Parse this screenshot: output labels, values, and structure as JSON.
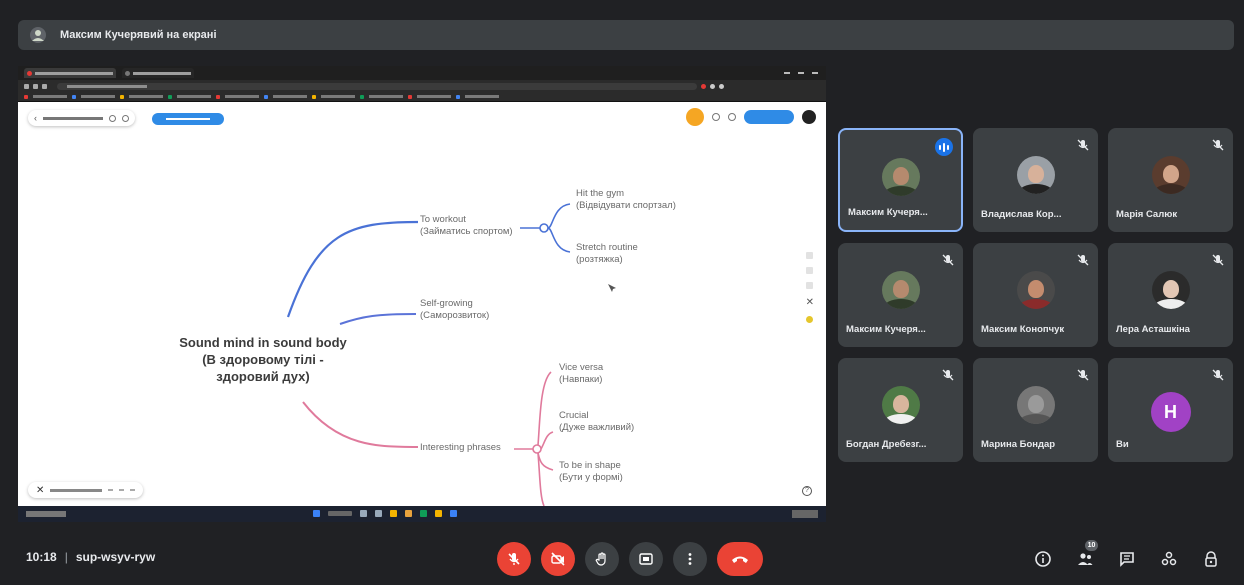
{
  "banner": {
    "text": "Максим Кучерявий на екрані"
  },
  "mindmap": {
    "root": [
      "Sound mind in sound body",
      "(В здоровому тілі -",
      "здоровий дух)"
    ],
    "branch_workout": [
      "To workout",
      "(Займатись спортом)"
    ],
    "leaf_gym": [
      "Hit the gym",
      "(Відвідувати спортзал)"
    ],
    "leaf_stretch": [
      "Stretch routine",
      "(розтяжка)"
    ],
    "branch_selfgrowing": [
      "Self-growing",
      "(Саморозвиток)"
    ],
    "branch_phrases": [
      "Interesting phrases"
    ],
    "leaf_vice": [
      "Vice versa",
      "(Навпаки)"
    ],
    "leaf_crucial": [
      "Crucial",
      "(Дуже важливий)"
    ],
    "leaf_shape": [
      "To be in shape",
      "(Бути у формі)"
    ],
    "colors": {
      "blue_branch": "#4a72d6",
      "pink_branch": "#e07a9c",
      "self_branch": "#5b73d8"
    }
  },
  "participants": [
    {
      "name": "Максим Кучеря...",
      "speaking": true
    },
    {
      "name": "Владислав Кор..."
    },
    {
      "name": "Марія Салюк"
    },
    {
      "name": "Максим Кучеря..."
    },
    {
      "name": "Максим Конопчук"
    },
    {
      "name": "Лера Асташкіна"
    },
    {
      "name": "Богдан Дребезг..."
    },
    {
      "name": "Марина Бондар"
    },
    {
      "name": "Ви",
      "initial": "H",
      "avatar_color": "#a142c5"
    }
  ],
  "meeting": {
    "time": "10:18",
    "separator": "|",
    "code": "sup-wsyv-ryw"
  },
  "participants_count": "10",
  "colors": {
    "accent_red": "#ea4335",
    "tile_bg": "#3c4043",
    "speaking_blue": "#1a73e8"
  },
  "icons": {
    "controls": [
      "mic-off-icon",
      "camera-off-icon",
      "raise-hand-icon",
      "present-icon",
      "more-options-icon",
      "end-call-icon"
    ],
    "right": [
      "info-icon",
      "people-icon",
      "chat-icon",
      "activities-icon",
      "host-controls-icon"
    ]
  }
}
